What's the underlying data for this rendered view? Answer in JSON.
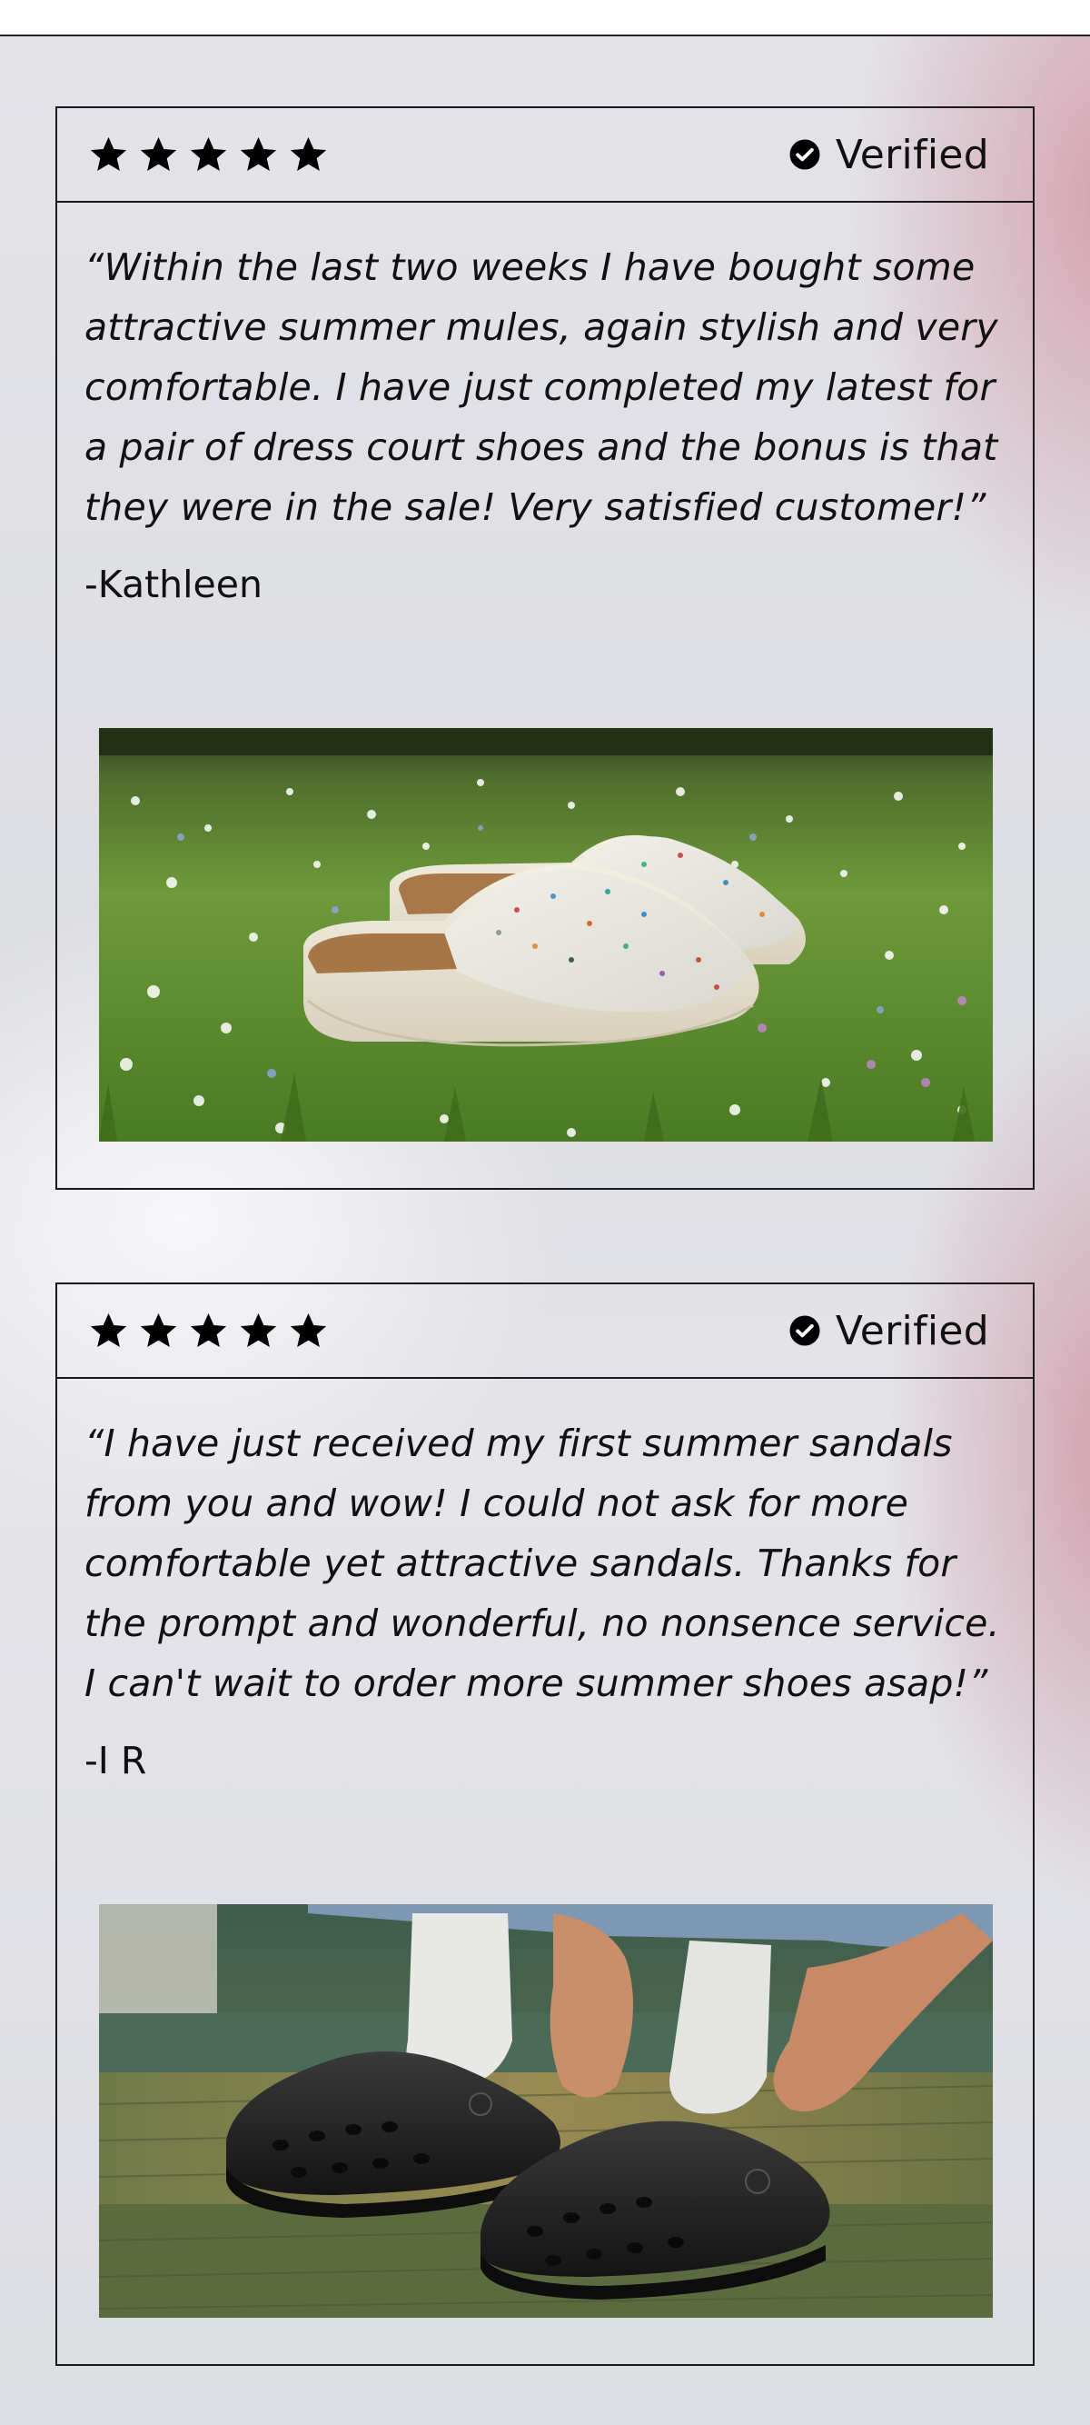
{
  "reviews": [
    {
      "rating_stars": 5,
      "verified_label": "Verified",
      "quote": "“Within the last two weeks I have bought some attractive summer mules, again stylish and very comfortable. I have just completed my latest for a pair of dress court shoes and the bonus is that they were in the sale! Very satisfied customer!”",
      "author": "-Kathleen",
      "image_subject": "speckled white clogs on grassy meadow"
    },
    {
      "rating_stars": 5,
      "verified_label": "Verified",
      "quote": "“I have just received my first summer sandals from you and wow! I could not ask for more comfortable yet attractive sandals. Thanks for the prompt and wonderful, no nonsence service. I can't wait to order more summer shoes asap!”",
      "author": "-I R",
      "image_subject": "black clogs with white socks on metal steps"
    }
  ],
  "icons": {
    "star": "star-icon",
    "verified": "check-circle-icon"
  },
  "colors": {
    "text": "#111111",
    "border": "#1a1a1a",
    "accent_pink": "#d096a5"
  }
}
